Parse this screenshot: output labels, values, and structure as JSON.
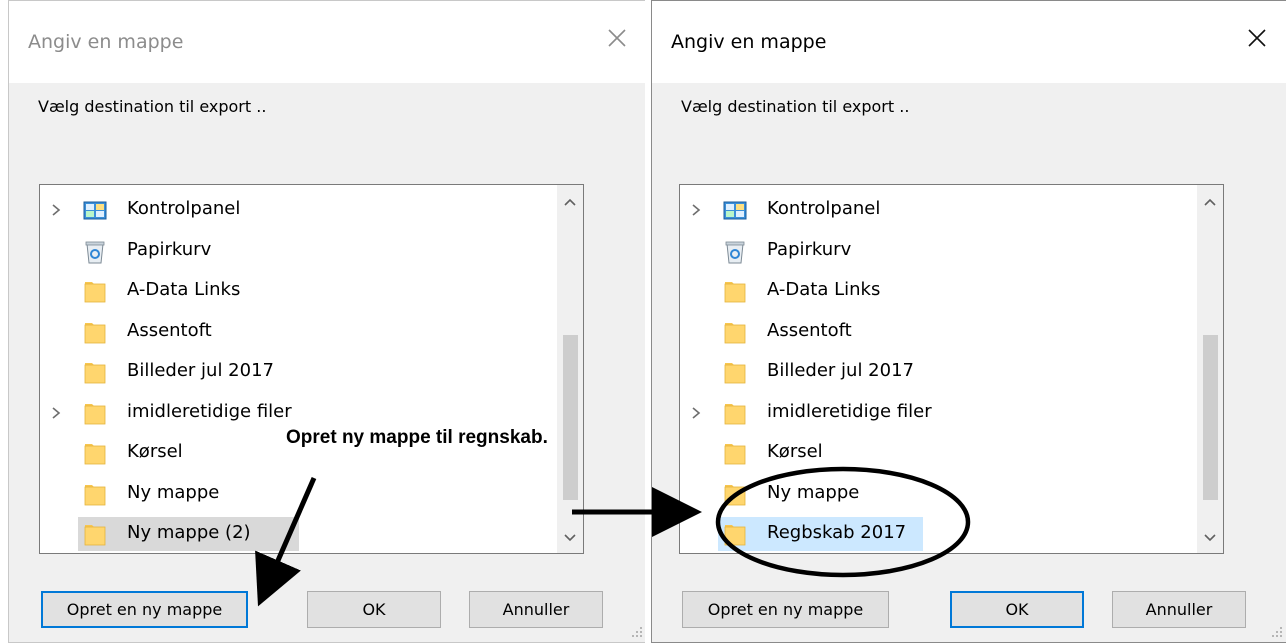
{
  "left_dialog": {
    "title": "Angiv en mappe",
    "description": "Vælg destination til export ..",
    "tree_items": [
      {
        "label": "Kontrolpanel",
        "icon": "control-panel-icon",
        "expandable": true
      },
      {
        "label": "Papirkurv",
        "icon": "recycle-bin-icon",
        "expandable": false
      },
      {
        "label": "A-Data Links",
        "icon": "folder-icon",
        "expandable": false
      },
      {
        "label": "Assentoft",
        "icon": "folder-icon",
        "expandable": false
      },
      {
        "label": "Billeder jul 2017",
        "icon": "folder-icon",
        "expandable": false
      },
      {
        "label": "imidleretidige filer",
        "icon": "folder-icon",
        "expandable": true
      },
      {
        "label": "Kørsel",
        "icon": "folder-icon",
        "expandable": false
      },
      {
        "label": "Ny mappe",
        "icon": "folder-icon",
        "expandable": false
      },
      {
        "label": "Ny mappe (2)",
        "icon": "folder-icon",
        "expandable": false,
        "selected": "inactive"
      }
    ],
    "buttons": {
      "new_folder": "Opret en ny mappe",
      "ok": "OK",
      "cancel": "Annuller"
    }
  },
  "right_dialog": {
    "title": "Angiv en mappe",
    "description": "Vælg destination til export ..",
    "tree_items": [
      {
        "label": "Kontrolpanel",
        "icon": "control-panel-icon",
        "expandable": true
      },
      {
        "label": "Papirkurv",
        "icon": "recycle-bin-icon",
        "expandable": false
      },
      {
        "label": "A-Data Links",
        "icon": "folder-icon",
        "expandable": false
      },
      {
        "label": "Assentoft",
        "icon": "folder-icon",
        "expandable": false
      },
      {
        "label": "Billeder jul 2017",
        "icon": "folder-icon",
        "expandable": false
      },
      {
        "label": "imidleretidige filer",
        "icon": "folder-icon",
        "expandable": true
      },
      {
        "label": "Kørsel",
        "icon": "folder-icon",
        "expandable": false
      },
      {
        "label": "Ny mappe",
        "icon": "folder-icon",
        "expandable": false
      },
      {
        "label": "Regbskab 2017",
        "icon": "folder-icon",
        "expandable": false,
        "selected": "active"
      }
    ],
    "buttons": {
      "new_folder": "Opret en ny mappe",
      "ok": "OK",
      "cancel": "Annuller"
    }
  },
  "annotation": {
    "text": "Opret ny mappe til regnskab."
  },
  "colors": {
    "selection_active": "#cce8ff",
    "selection_inactive": "#d9d9d9",
    "focus_border": "#0078d7",
    "folder": "#ffd66e"
  }
}
